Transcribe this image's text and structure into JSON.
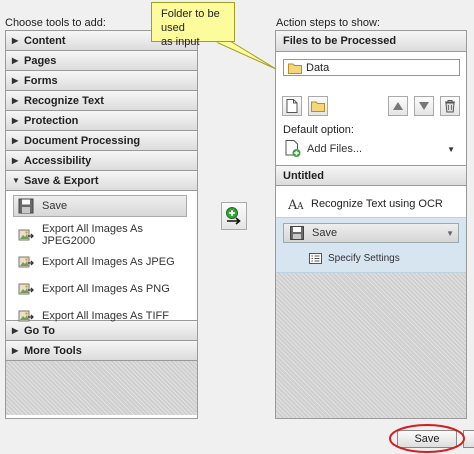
{
  "left": {
    "caption": "Choose tools to add:",
    "categories_top": [
      {
        "label": "Content",
        "expanded": false
      },
      {
        "label": "Pages",
        "expanded": false
      },
      {
        "label": "Forms",
        "expanded": false
      },
      {
        "label": "Recognize Text",
        "expanded": false
      },
      {
        "label": "Protection",
        "expanded": false
      },
      {
        "label": "Document Processing",
        "expanded": false
      },
      {
        "label": "Accessibility",
        "expanded": false
      },
      {
        "label": "Save & Export",
        "expanded": true
      }
    ],
    "save_export_tools": [
      {
        "label": "Save",
        "icon": "floppy-disk-icon",
        "selected": true
      },
      {
        "label": "Export All Images As JPEG2000",
        "icon": "export-image-icon",
        "selected": false
      },
      {
        "label": "Export All Images As JPEG",
        "icon": "export-image-icon",
        "selected": false
      },
      {
        "label": "Export All Images As PNG",
        "icon": "export-image-icon",
        "selected": false
      },
      {
        "label": "Export All Images As TIFF",
        "icon": "export-image-icon",
        "selected": false
      }
    ],
    "categories_bottom": [
      {
        "label": "Go To",
        "expanded": false
      },
      {
        "label": "More Tools",
        "expanded": false
      }
    ]
  },
  "callout": {
    "line1": "Folder to be used",
    "line2": "as input",
    "color": "#fcfc9c"
  },
  "right": {
    "caption": "Action steps to show:",
    "files_header": "Files to be Processed",
    "data_item": "Data",
    "default_option_label": "Default option:",
    "add_files_label": "Add Files...",
    "untitled_header": "Untitled",
    "steps": {
      "ocr_label": "Recognize Text using OCR",
      "save_label": "Save",
      "specify_settings": "Specify Settings"
    },
    "selected_step_color": "#d7e5f1"
  },
  "buttons": {
    "save": "Save",
    "highlight_color": "#d02020"
  }
}
